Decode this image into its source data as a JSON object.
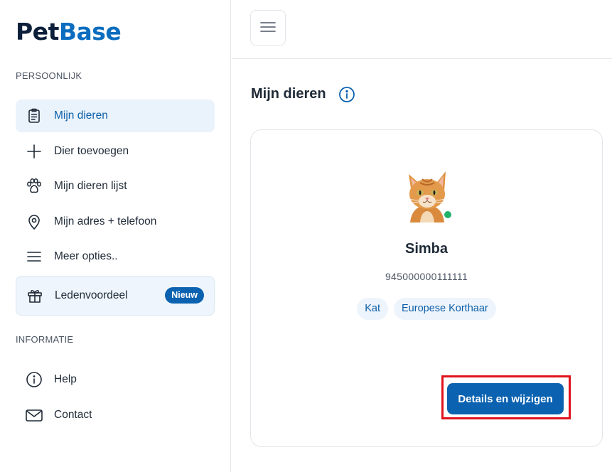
{
  "app": {
    "logo_part1": "Pet",
    "logo_part2": "Base"
  },
  "sidebar": {
    "section_personal": "PERSOONLIJK",
    "section_info": "INFORMATIE",
    "items": [
      {
        "label": "Mijn dieren",
        "icon": "clipboard-icon"
      },
      {
        "label": "Dier toevoegen",
        "icon": "plus-icon"
      },
      {
        "label": "Mijn dieren lijst",
        "icon": "paw-icon"
      },
      {
        "label": "Mijn adres + telefoon",
        "icon": "location-pin-icon"
      },
      {
        "label": "Meer opties..",
        "icon": "menu-lines-icon"
      }
    ],
    "promo": {
      "label": "Ledenvoordeel",
      "badge": "Nieuw",
      "icon": "gift-icon"
    },
    "info_items": [
      {
        "label": "Help",
        "icon": "info-circle-icon"
      },
      {
        "label": "Contact",
        "icon": "envelope-icon"
      }
    ]
  },
  "main": {
    "title": "Mijn dieren",
    "pet": {
      "name": "Simba",
      "chip_number": "945000000111111",
      "tags": [
        "Kat",
        "Europese Korthaar"
      ],
      "status_color": "#22b36b"
    },
    "details_button": "Details en wijzigen"
  },
  "colors": {
    "brand": "#0b62b0",
    "highlight": "#e0121b"
  }
}
